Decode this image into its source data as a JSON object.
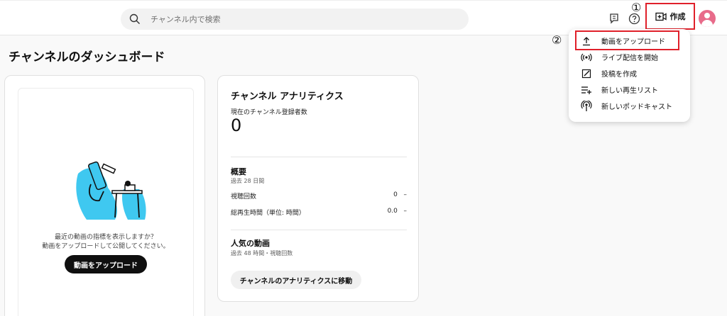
{
  "search": {
    "placeholder": "チャンネル内で検索"
  },
  "header": {
    "create_label": "作成"
  },
  "markers": {
    "one": "①",
    "two": "②"
  },
  "page": {
    "title": "チャンネルのダッシュボード"
  },
  "left_card": {
    "empty_line1": "最近の動画の指標を表示しますか？",
    "empty_line2": "動画をアップロードして公開してください。",
    "upload_button": "動画をアップロード"
  },
  "analytics": {
    "title": "チャンネル アナリティクス",
    "subscribers_label": "現在のチャンネル登録者数",
    "subscribers_value": "0",
    "summary_title": "概要",
    "summary_period": "過去 28 日間",
    "metrics": [
      {
        "label": "視聴回数",
        "value": "0",
        "change": "–"
      },
      {
        "label": "総再生時間（単位: 時間）",
        "value": "0.0",
        "change": "–"
      }
    ],
    "popular_title": "人気の動画",
    "popular_period": "過去 48 時間・視聴回数",
    "goto_button": "チャンネルのアナリティクスに移動"
  },
  "create_menu": {
    "items": [
      {
        "label": "動画をアップロード",
        "icon": "upload-icon"
      },
      {
        "label": "ライブ配信を開始",
        "icon": "live-icon"
      },
      {
        "label": "投稿を作成",
        "icon": "edit-icon"
      },
      {
        "label": "新しい再生リスト",
        "icon": "playlist-add-icon"
      },
      {
        "label": "新しいポッドキャスト",
        "icon": "podcast-icon"
      }
    ]
  },
  "colors": {
    "highlight": "#e0202a",
    "illustration": "#3fc8f0",
    "avatar": "#e86b8a"
  }
}
